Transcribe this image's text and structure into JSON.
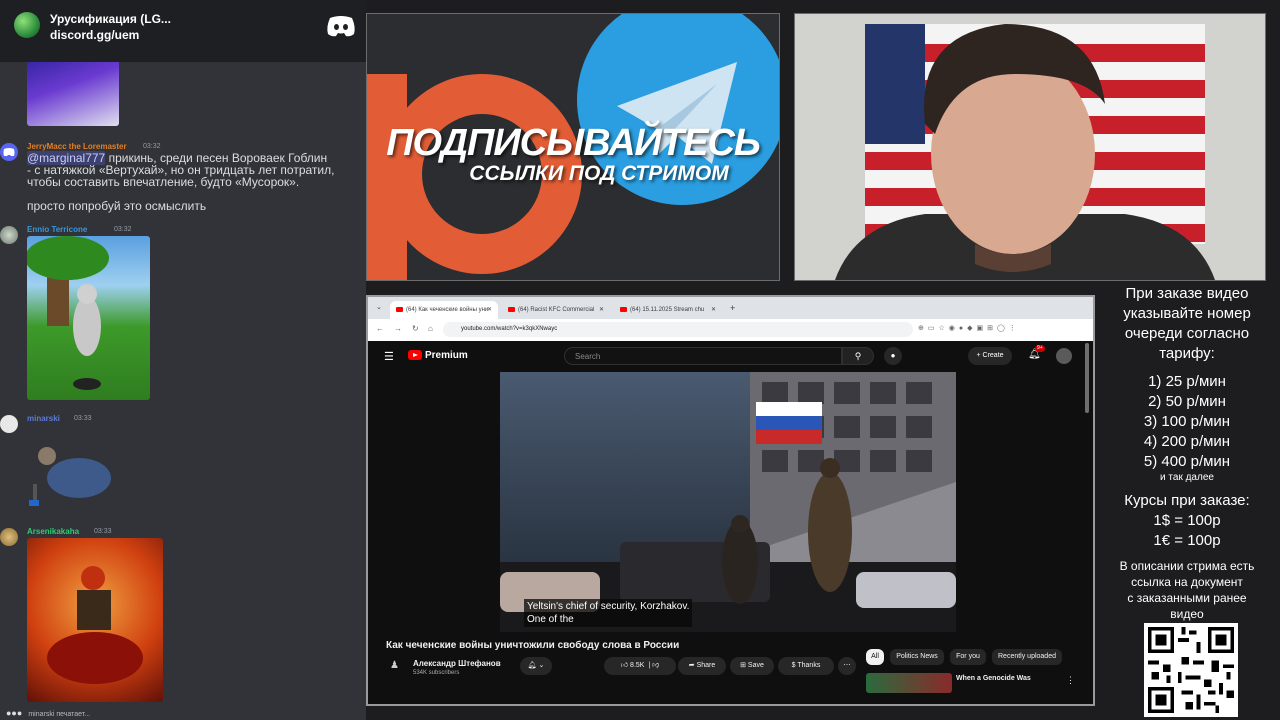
{
  "discord": {
    "server_name": "Урусификация (LG...",
    "invite": "discord.gg/uem",
    "colors": {
      "background": "#313338",
      "header": "#1e1f22",
      "blurple": "#5865f2"
    },
    "messages": [
      {
        "user": "JerryMacc the Loremaster",
        "user_color": "#e67e22",
        "time": "03:32",
        "lines": [
          {
            "mention": "@marginal777",
            "text": " прикинь, среди песен Вороваек Гоблин"
          },
          {
            "text": "- с натяжкой «Вертухай», но он тридцать лет потратил,"
          },
          {
            "text": "чтобы составить впечатление, будто «Мусорок»."
          },
          {
            "text": "просто попробуй это осмыслить"
          }
        ]
      },
      {
        "user": "Ennio Terricone",
        "user_color": "#3498db",
        "time": "03:32",
        "image": "gif-rat-tree"
      },
      {
        "user": "minarski",
        "user_color": "#5b7bd5",
        "time": "03:33",
        "image": "gif-old-woman"
      },
      {
        "user": "Arsenikakaha",
        "user_color": "#2ecc71",
        "time": "03:33",
        "image": "gif-man-in-cauldron"
      }
    ],
    "typing": "minarski печатает..."
  },
  "banner": {
    "headline": "ПОДПИСЫВАЙТЕСЬ",
    "subline": "ССЫЛКИ ПОД СТРИМОМ",
    "icons": [
      "patreon-icon",
      "telegram-icon"
    ]
  },
  "browser": {
    "tabs": [
      {
        "title": "(64) Как чеченские войны уни",
        "active": true
      },
      {
        "title": "(64) Racist KFC Commercial"
      },
      {
        "title": "(64) 15.11.2025 Stream chu"
      }
    ],
    "url": "youtube.com/watch?v=k3qkXNwayc"
  },
  "youtube": {
    "brand": "Premium",
    "search_placeholder": "Search",
    "create_label": "Create",
    "notifications": "9+",
    "caption_text": "Yeltsin's chief of security, Korzhakov.\nOne of the",
    "video_title": "Как чеченские войны уничтожили свободу слова в России",
    "channel_name": "Александр Штефанов",
    "subscribers": "534K subscribers",
    "likes": "8.5K",
    "share_label": "Share",
    "save_label": "Save",
    "thanks_label": "Thanks",
    "chips": [
      "All",
      "Politics News",
      "For you",
      "Recently uploaded"
    ],
    "recommended_title": "When a Genocide Was"
  },
  "info_panel": {
    "intro": [
      "При заказе видео",
      "указывайте номер",
      "очереди согласно",
      "тарифу:"
    ],
    "tariffs": [
      "1) 25 р/мин",
      "2) 50 р/мин",
      "3) 100 р/мин",
      "4) 200 р/мин",
      "5) 400 р/мин"
    ],
    "and_more": "и так далее",
    "rates_title": "Курсы при заказе:",
    "rates": [
      "1$ = 100р",
      "1€ = 100р"
    ],
    "description": [
      "В описании стрима есть",
      "ссылка на документ",
      "с заказанными ранее",
      "видео"
    ]
  }
}
